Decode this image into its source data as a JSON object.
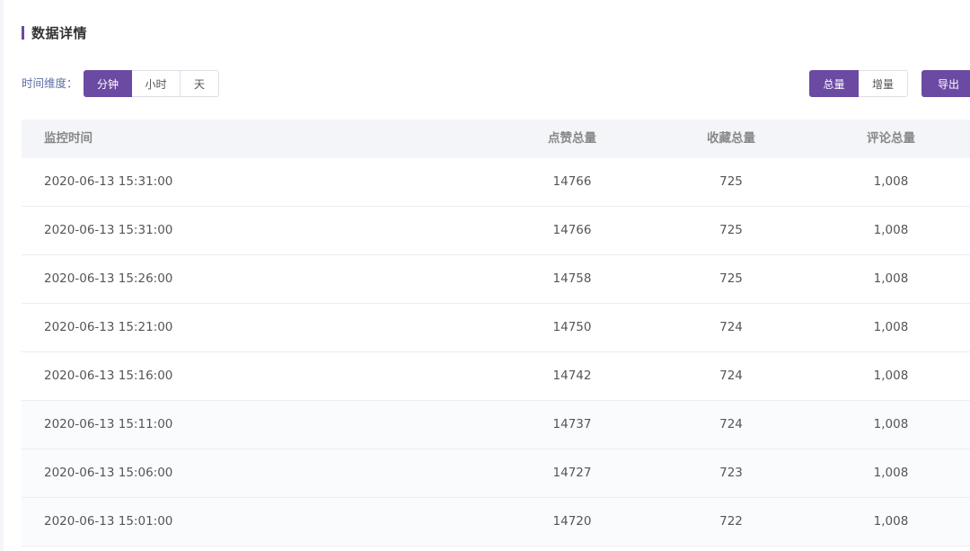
{
  "section": {
    "title": "数据详情"
  },
  "toolbar": {
    "dimension_label": "时间维度：",
    "dimension_options": [
      "分钟",
      "小时",
      "天"
    ],
    "dimension_selected": "分钟",
    "mode_options": [
      "总量",
      "增量"
    ],
    "mode_selected": "总量",
    "export_label": "导出"
  },
  "table": {
    "columns": [
      "监控时间",
      "点赞总量",
      "收藏总量",
      "评论总量"
    ],
    "rows": [
      {
        "time": "2020-06-13 15:31:00",
        "likes": "14766",
        "favorites": "725",
        "comments": "1,008"
      },
      {
        "time": "2020-06-13 15:31:00",
        "likes": "14766",
        "favorites": "725",
        "comments": "1,008"
      },
      {
        "time": "2020-06-13 15:26:00",
        "likes": "14758",
        "favorites": "725",
        "comments": "1,008"
      },
      {
        "time": "2020-06-13 15:21:00",
        "likes": "14750",
        "favorites": "724",
        "comments": "1,008"
      },
      {
        "time": "2020-06-13 15:16:00",
        "likes": "14742",
        "favorites": "724",
        "comments": "1,008"
      },
      {
        "time": "2020-06-13 15:11:00",
        "likes": "14737",
        "favorites": "724",
        "comments": "1,008"
      },
      {
        "time": "2020-06-13 15:06:00",
        "likes": "14727",
        "favorites": "723",
        "comments": "1,008"
      },
      {
        "time": "2020-06-13 15:01:00",
        "likes": "14720",
        "favorites": "722",
        "comments": "1,008"
      }
    ]
  },
  "colors": {
    "accent": "#6b4aa3",
    "header_bg": "#f3f5f8",
    "label_blue": "#5d6fa5"
  }
}
